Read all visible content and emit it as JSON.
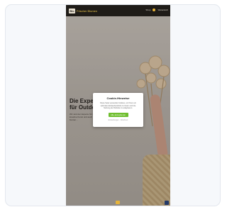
{
  "brand": {
    "mark": "Bio",
    "name": "Frischer Blumen"
  },
  "nav": {
    "link_1": "Shop",
    "link_2": "Warenkorb"
  },
  "hero": {
    "title": "Die Experten für Outdoor…",
    "copy": "Wir sind der Experte für natürliche Deko. Die kreative Kunst und auch professionell vom bunten…"
  },
  "consent": {
    "title": "Cookie-Hinweise",
    "text": "Diese Seite verwendet Cookies, um Ihnen ein optimales Einkaufserlebnis zu bieten und die Nutzung der Website zu analysieren.",
    "accept_label": "Alle akzeptieren",
    "links": "Einstellungen  ·  Ablehnen"
  }
}
